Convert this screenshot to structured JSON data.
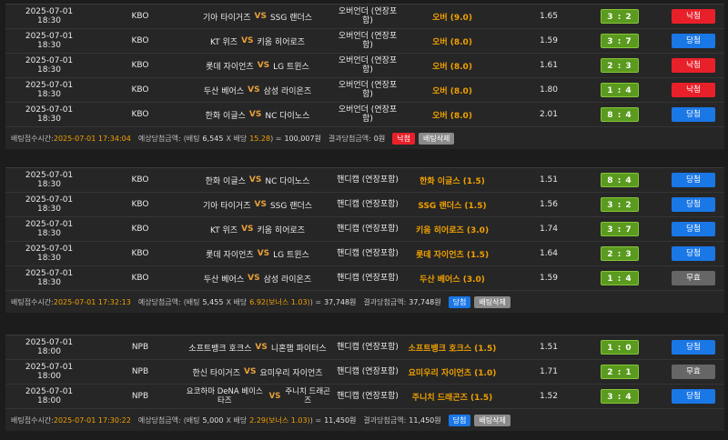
{
  "slips": [
    {
      "rows": [
        {
          "time": "2025-07-01 18:30",
          "league": "KBO",
          "home": "기아 타이거즈",
          "vs": "VS",
          "away": "SSG 랜더스",
          "type": "오버언더 (연장포함)",
          "pick": "오버 (9.0)",
          "odds": "1.65",
          "score": "3 : 2",
          "result": "낙첨",
          "result_kind": "lose"
        },
        {
          "time": "2025-07-01 18:30",
          "league": "KBO",
          "home": "KT 위즈",
          "vs": "VS",
          "away": "키움 히어로즈",
          "type": "오버언더 (연장포함)",
          "pick": "오버 (8.0)",
          "odds": "1.59",
          "score": "3 : 7",
          "result": "당첨",
          "result_kind": "win"
        },
        {
          "time": "2025-07-01 18:30",
          "league": "KBO",
          "home": "롯데 자이언츠",
          "vs": "VS",
          "away": "LG 트윈스",
          "type": "오버언더 (연장포함)",
          "pick": "오버 (8.0)",
          "odds": "1.61",
          "score": "2 : 3",
          "result": "낙첨",
          "result_kind": "lose"
        },
        {
          "time": "2025-07-01 18:30",
          "league": "KBO",
          "home": "두산 베어스",
          "vs": "VS",
          "away": "삼성 라이온즈",
          "type": "오버언더 (연장포함)",
          "pick": "오버 (8.0)",
          "odds": "1.80",
          "score": "1 : 4",
          "result": "낙첨",
          "result_kind": "lose"
        },
        {
          "time": "2025-07-01 18:30",
          "league": "KBO",
          "home": "한화 이글스",
          "vs": "VS",
          "away": "NC 다이노스",
          "type": "오버언더 (연장포함)",
          "pick": "오버 (8.0)",
          "odds": "2.01",
          "score": "8 : 4",
          "result": "당첨",
          "result_kind": "win"
        }
      ],
      "footer": {
        "time_label": "배팅접수시간:",
        "time": "2025-07-01 17:34:04",
        "expect_label": "예상당첨금액:",
        "expect_open": "(배팅",
        "stake": "6,545",
        "x": "X 배당",
        "odds": "15.28",
        "expect_close": ") =",
        "expect": "100,007원",
        "result_label": "결과당첨금액:",
        "result": "0원",
        "status": "낙첨",
        "status_kind": "lose",
        "delete": "배팅삭제"
      }
    },
    {
      "rows": [
        {
          "time": "2025-07-01 18:30",
          "league": "KBO",
          "home": "한화 이글스",
          "vs": "VS",
          "away": "NC 다이노스",
          "type": "핸디캡 (연장포함)",
          "pick": "한화 이글스 (1.5)",
          "odds": "1.51",
          "score": "8 : 4",
          "result": "당첨",
          "result_kind": "win"
        },
        {
          "time": "2025-07-01 18:30",
          "league": "KBO",
          "home": "기아 타이거즈",
          "vs": "VS",
          "away": "SSG 랜더스",
          "type": "핸디캡 (연장포함)",
          "pick": "SSG 랜더스 (1.5)",
          "odds": "1.56",
          "score": "3 : 2",
          "result": "당첨",
          "result_kind": "win"
        },
        {
          "time": "2025-07-01 18:30",
          "league": "KBO",
          "home": "KT 위즈",
          "vs": "VS",
          "away": "키움 히어로즈",
          "type": "핸디캡 (연장포함)",
          "pick": "키움 히어로즈 (3.0)",
          "odds": "1.74",
          "score": "3 : 7",
          "result": "당첨",
          "result_kind": "win"
        },
        {
          "time": "2025-07-01 18:30",
          "league": "KBO",
          "home": "롯데 자이언츠",
          "vs": "VS",
          "away": "LG 트윈스",
          "type": "핸디캡 (연장포함)",
          "pick": "롯데 자이언츠 (1.5)",
          "odds": "1.64",
          "score": "2 : 3",
          "result": "당첨",
          "result_kind": "win"
        },
        {
          "time": "2025-07-01 18:30",
          "league": "KBO",
          "home": "두산 베어스",
          "vs": "VS",
          "away": "삼성 라이온즈",
          "type": "핸디캡 (연장포함)",
          "pick": "두산 베어스 (3.0)",
          "odds": "1.59",
          "score": "1 : 4",
          "result": "무효",
          "result_kind": "push"
        }
      ],
      "footer": {
        "time_label": "배팅접수시간:",
        "time": "2025-07-01 17:32:13",
        "expect_label": "예상당첨금액:",
        "expect_open": "(배팅",
        "stake": "5,455",
        "x": "X 배당",
        "odds": "6.92(보너스 1.03)",
        "expect_close": ") =",
        "expect": "37,748원",
        "result_label": "결과당첨금액:",
        "result": "37,748원",
        "status": "당첨",
        "status_kind": "win",
        "delete": "배팅삭제"
      }
    },
    {
      "rows": [
        {
          "time": "2025-07-01 18:00",
          "league": "NPB",
          "home": "소프트뱅크 호크스",
          "vs": "VS",
          "away": "니혼햄 파이터스",
          "type": "핸디캡 (연장포함)",
          "pick": "소프트뱅크 호크스 (1.5)",
          "odds": "1.51",
          "score": "1 : 0",
          "result": "당첨",
          "result_kind": "win"
        },
        {
          "time": "2025-07-01 18:00",
          "league": "NPB",
          "home": "한신 타이거즈",
          "vs": "VS",
          "away": "요미우리 자이언츠",
          "type": "핸디캡 (연장포함)",
          "pick": "요미우리 자이언츠 (1.0)",
          "odds": "1.71",
          "score": "2 : 1",
          "result": "무효",
          "result_kind": "push"
        },
        {
          "time": "2025-07-01 18:00",
          "league": "NPB",
          "home": "요코하마 DeNA 베이스타즈",
          "vs": "VS",
          "away": "주니치 드래곤즈",
          "type": "핸디캡 (연장포함)",
          "pick": "주니치 드래곤즈 (1.5)",
          "odds": "1.52",
          "score": "3 : 4",
          "result": "당첨",
          "result_kind": "win",
          "two_line": true
        }
      ],
      "footer": {
        "time_label": "배팅접수시간:",
        "time": "2025-07-01 17:30:22",
        "expect_label": "예상당첨금액:",
        "expect_open": "(배팅",
        "stake": "5,000",
        "x": "X 배당",
        "odds": "2.29(보너스 1.03)",
        "expect_close": ") =",
        "expect": "11,450원",
        "result_label": "결과당첨금액:",
        "result": "11,450원",
        "status": "당첨",
        "status_kind": "win",
        "delete": "배팅삭제"
      }
    }
  ],
  "colors": {
    "lose": "#e8202a",
    "win": "#1a77e6",
    "push": "#666666",
    "score_bg": "#5a9a1e",
    "pick": "#f0a000"
  }
}
